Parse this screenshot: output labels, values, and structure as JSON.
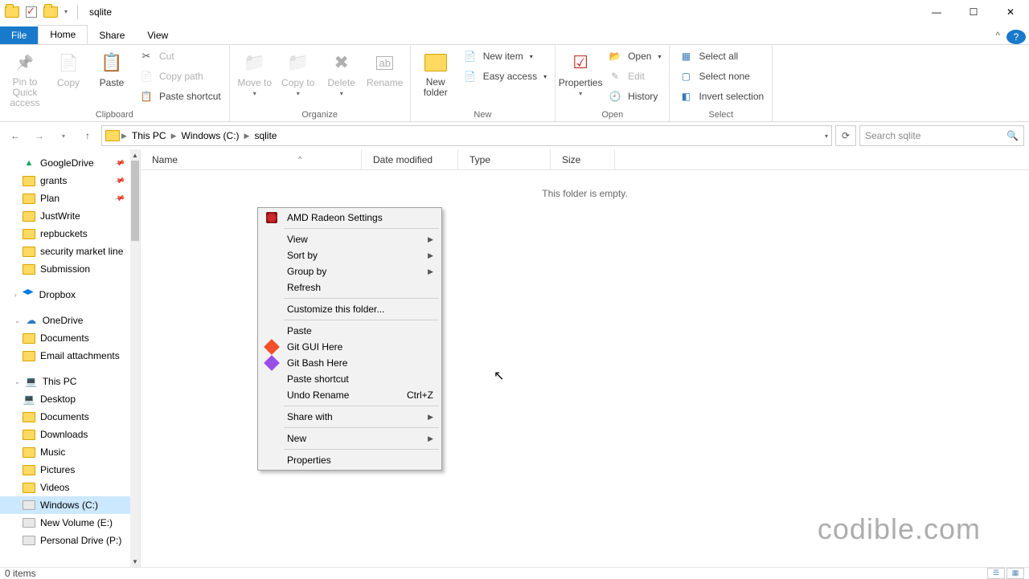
{
  "title": "sqlite",
  "tabs": {
    "file": "File",
    "home": "Home",
    "share": "Share",
    "view": "View"
  },
  "ribbon": {
    "clipboard": {
      "label": "Clipboard",
      "pin": "Pin to Quick access",
      "copy": "Copy",
      "paste": "Paste",
      "cut": "Cut",
      "copy_path": "Copy path",
      "paste_shortcut": "Paste shortcut"
    },
    "organize": {
      "label": "Organize",
      "move_to": "Move to",
      "copy_to": "Copy to",
      "delete": "Delete",
      "rename": "Rename"
    },
    "new": {
      "label": "New",
      "new_folder": "New folder",
      "new_item": "New item",
      "easy_access": "Easy access"
    },
    "open": {
      "label": "Open",
      "properties": "Properties",
      "open": "Open",
      "edit": "Edit",
      "history": "History"
    },
    "select": {
      "label": "Select",
      "select_all": "Select all",
      "select_none": "Select none",
      "invert": "Invert selection"
    }
  },
  "breadcrumb": {
    "pc": "This PC",
    "drive": "Windows (C:)",
    "folder": "sqlite"
  },
  "search_placeholder": "Search sqlite",
  "columns": {
    "name": "Name",
    "date": "Date modified",
    "type": "Type",
    "size": "Size"
  },
  "empty_message": "This folder is empty.",
  "tree": {
    "googledrive": "GoogleDrive",
    "grants": "grants",
    "plan": "Plan",
    "justwrite": "JustWrite",
    "repbuckets": "repbuckets",
    "secmarket": "security market line",
    "submission": "Submission",
    "dropbox": "Dropbox",
    "onedrive": "OneDrive",
    "documents1": "Documents",
    "email_att": "Email attachments",
    "thispc": "This PC",
    "desktop": "Desktop",
    "documents2": "Documents",
    "downloads": "Downloads",
    "music": "Music",
    "pictures": "Pictures",
    "videos": "Videos",
    "windowsc": "Windows (C:)",
    "newvol": "New Volume (E:)",
    "personal": "Personal Drive (P:)"
  },
  "context_menu": {
    "amd": "AMD Radeon Settings",
    "view": "View",
    "sort_by": "Sort by",
    "group_by": "Group by",
    "refresh": "Refresh",
    "customize": "Customize this folder...",
    "paste": "Paste",
    "git_gui": "Git GUI Here",
    "git_bash": "Git Bash Here",
    "paste_shortcut": "Paste shortcut",
    "undo_rename": "Undo Rename",
    "undo_shortcut": "Ctrl+Z",
    "share_with": "Share with",
    "new": "New",
    "properties": "Properties"
  },
  "status": "0 items",
  "watermark": "codible.com"
}
